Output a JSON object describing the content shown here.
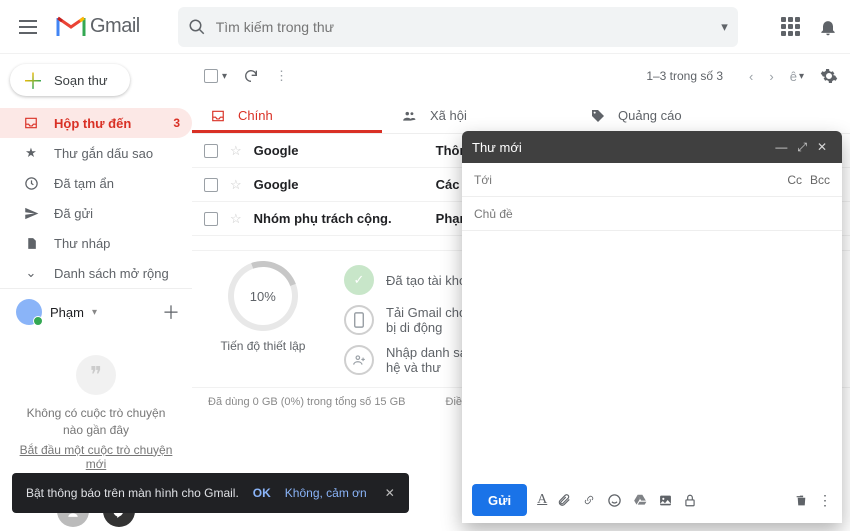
{
  "header": {
    "product": "Gmail",
    "search_placeholder": "Tìm kiếm trong thư"
  },
  "compose_label": "Soạn thư",
  "nav": {
    "inbox": "Hộp thư đến",
    "inbox_count": "3",
    "starred": "Thư gắn dấu sao",
    "snoozed": "Đã tạm ẩn",
    "sent": "Đã gửi",
    "drafts": "Thư nháp",
    "more": "Danh sách mở rộng"
  },
  "user": {
    "name": "Phạm"
  },
  "hangouts": {
    "empty": "Không có cuộc trò chuyện nào gần đây",
    "start": "Bắt đầu một cuộc trò chuyện mới"
  },
  "toolbar": {
    "range": "1–3 trong số 3",
    "lang_badge": "ê"
  },
  "tabs": {
    "primary": "Chính",
    "social": "Xã hội",
    "promotions": "Quảng cáo"
  },
  "messages": [
    {
      "sender": "Google",
      "subject": "Thông bá"
    },
    {
      "sender": "Google",
      "subject": "Các cài t"
    },
    {
      "sender": "Nhóm phụ trách cộng.",
      "subject": "Phạm, hã"
    }
  ],
  "setup": {
    "percent": "10%",
    "progress_label": "Tiến độ thiết lập",
    "step_done": "Đã tạo tài khoản",
    "step_mobile": "Tải Gmail cho thiết bị di động",
    "step_import": "Nhập danh sách liên hệ và thư"
  },
  "footer": {
    "storage": "Đã dùng 0 GB (0%) trong tổng số 15 GB",
    "terms": "Điều kho"
  },
  "toast": {
    "text": "Bật thông báo trên màn hình cho Gmail.",
    "ok": "OK",
    "no": "Không, cảm ơn"
  },
  "composer": {
    "title": "Thư mới",
    "to": "Tới",
    "cc": "Cc",
    "bcc": "Bcc",
    "subject": "Chủ đề",
    "send": "Gửi"
  }
}
